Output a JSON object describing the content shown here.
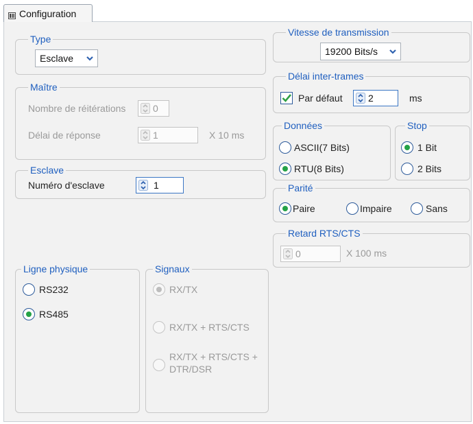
{
  "tab": {
    "label": "Configuration"
  },
  "type": {
    "legend": "Type",
    "value": "Esclave"
  },
  "maitre": {
    "legend": "Maître",
    "retries_label": "Nombre de réitérations",
    "retries_value": "0",
    "response_delay_label": "Délai de réponse",
    "response_delay_value": "1",
    "response_delay_unit": "X 10 ms"
  },
  "esclave": {
    "legend": "Esclave",
    "slave_number_label": "Numéro d'esclave",
    "slave_number_value": "1"
  },
  "vitesse": {
    "legend": "Vitesse de transmission",
    "value": "19200 Bits/s"
  },
  "delai_inter_trames": {
    "legend": "Délai inter-trames",
    "default_label": "Par défaut",
    "default_checked": true,
    "value": "2",
    "unit": "ms"
  },
  "donnees": {
    "legend": "Données",
    "options": [
      "ASCII(7 Bits)",
      "RTU(8 Bits)"
    ],
    "selected": "RTU(8 Bits)"
  },
  "stop": {
    "legend": "Stop",
    "options": [
      "1 Bit",
      "2 Bits"
    ],
    "selected": "1 Bit"
  },
  "parite": {
    "legend": "Parité",
    "options": [
      "Paire",
      "Impaire",
      "Sans"
    ],
    "selected": "Paire"
  },
  "retard_rts_cts": {
    "legend": "Retard RTS/CTS",
    "value": "0",
    "unit": "X 100 ms"
  },
  "ligne_physique": {
    "legend": "Ligne physique",
    "options": [
      "RS232",
      "RS485"
    ],
    "selected": "RS485"
  },
  "signaux": {
    "legend": "Signaux",
    "options": [
      "RX/TX",
      "RX/TX + RTS/CTS",
      "RX/TX + RTS/CTS +",
      "DTR/DSR"
    ],
    "selected": "RX/TX"
  },
  "colors": {
    "legend_blue": "#1f5fbf",
    "radio_selected_green": "#25a247",
    "check_green": "#2ea043",
    "disabled_gray": "#9a9a9a",
    "panel_bg": "#f2f2f2"
  }
}
